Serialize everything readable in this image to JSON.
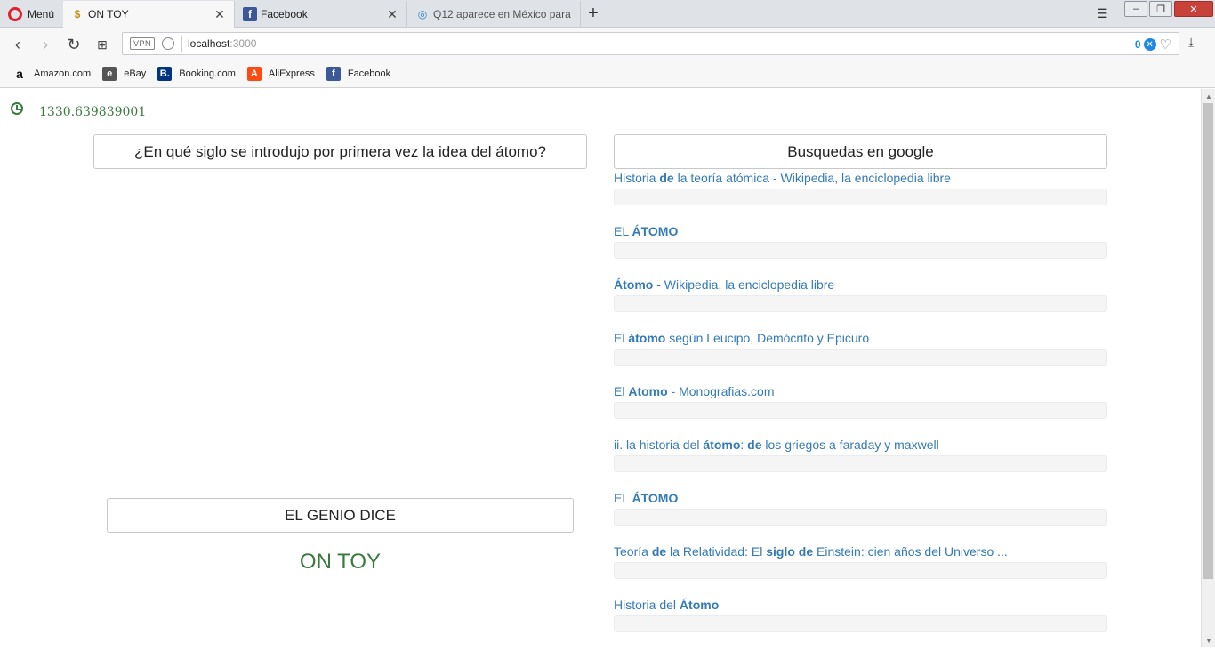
{
  "browser": {
    "menu_label": "Menú",
    "tabs": [
      {
        "title": "ON TOY",
        "favicon": "$"
      },
      {
        "title": "Facebook",
        "favicon": "f"
      },
      {
        "title": "Q12 aparece en México para",
        "favicon": "◎"
      }
    ],
    "vpn_label": "VPN",
    "url_host": "localhost",
    "url_port": ":3000",
    "adblock_count": "0",
    "bookmarks": [
      {
        "label": "Amazon.com",
        "icon": "a"
      },
      {
        "label": "eBay",
        "icon": "e"
      },
      {
        "label": "Booking.com",
        "icon": "B."
      },
      {
        "label": "AliExpress",
        "icon": "A"
      },
      {
        "label": "Facebook",
        "icon": "f"
      }
    ]
  },
  "page": {
    "timer_value": "1330.639839001",
    "question": "¿En qué siglo se introdujo por primera vez la idea del átomo?",
    "genie_label": "EL GENIO DICE",
    "genie_answer": "ON TOY",
    "search_title": "Busquedas en google",
    "results": [
      {
        "parts": [
          [
            "Historia ",
            false
          ],
          [
            "de",
            true
          ],
          [
            " la teoría atómica - Wikipedia, la enciclopedia libre",
            false
          ]
        ]
      },
      {
        "parts": [
          [
            "EL ",
            false
          ],
          [
            "ÁTOMO",
            true
          ]
        ]
      },
      {
        "parts": [
          [
            "Átomo",
            true
          ],
          [
            " - Wikipedia, la enciclopedia libre",
            false
          ]
        ]
      },
      {
        "parts": [
          [
            "El ",
            false
          ],
          [
            "átomo",
            true
          ],
          [
            " según Leucipo, Demócrito y Epicuro",
            false
          ]
        ]
      },
      {
        "parts": [
          [
            "El ",
            false
          ],
          [
            "Atomo",
            true
          ],
          [
            " - Monografias.com",
            false
          ]
        ]
      },
      {
        "parts": [
          [
            "ii. la historia del ",
            false
          ],
          [
            "átomo",
            true
          ],
          [
            ": ",
            false
          ],
          [
            "de",
            true
          ],
          [
            " los griegos a faraday y maxwell",
            false
          ]
        ]
      },
      {
        "parts": [
          [
            "EL ",
            false
          ],
          [
            "ÁTOMO",
            true
          ]
        ]
      },
      {
        "parts": [
          [
            "Teoría ",
            false
          ],
          [
            "de",
            true
          ],
          [
            " la Relatividad: El ",
            false
          ],
          [
            "siglo de",
            true
          ],
          [
            " Einstein: cien años del Universo ...",
            false
          ]
        ]
      },
      {
        "parts": [
          [
            "Historia del ",
            false
          ],
          [
            "Átomo",
            true
          ]
        ]
      }
    ]
  },
  "colors": {
    "accent_green": "#3b7a3f",
    "link_blue": "#337ab7",
    "opera_red": "#e0202c"
  }
}
